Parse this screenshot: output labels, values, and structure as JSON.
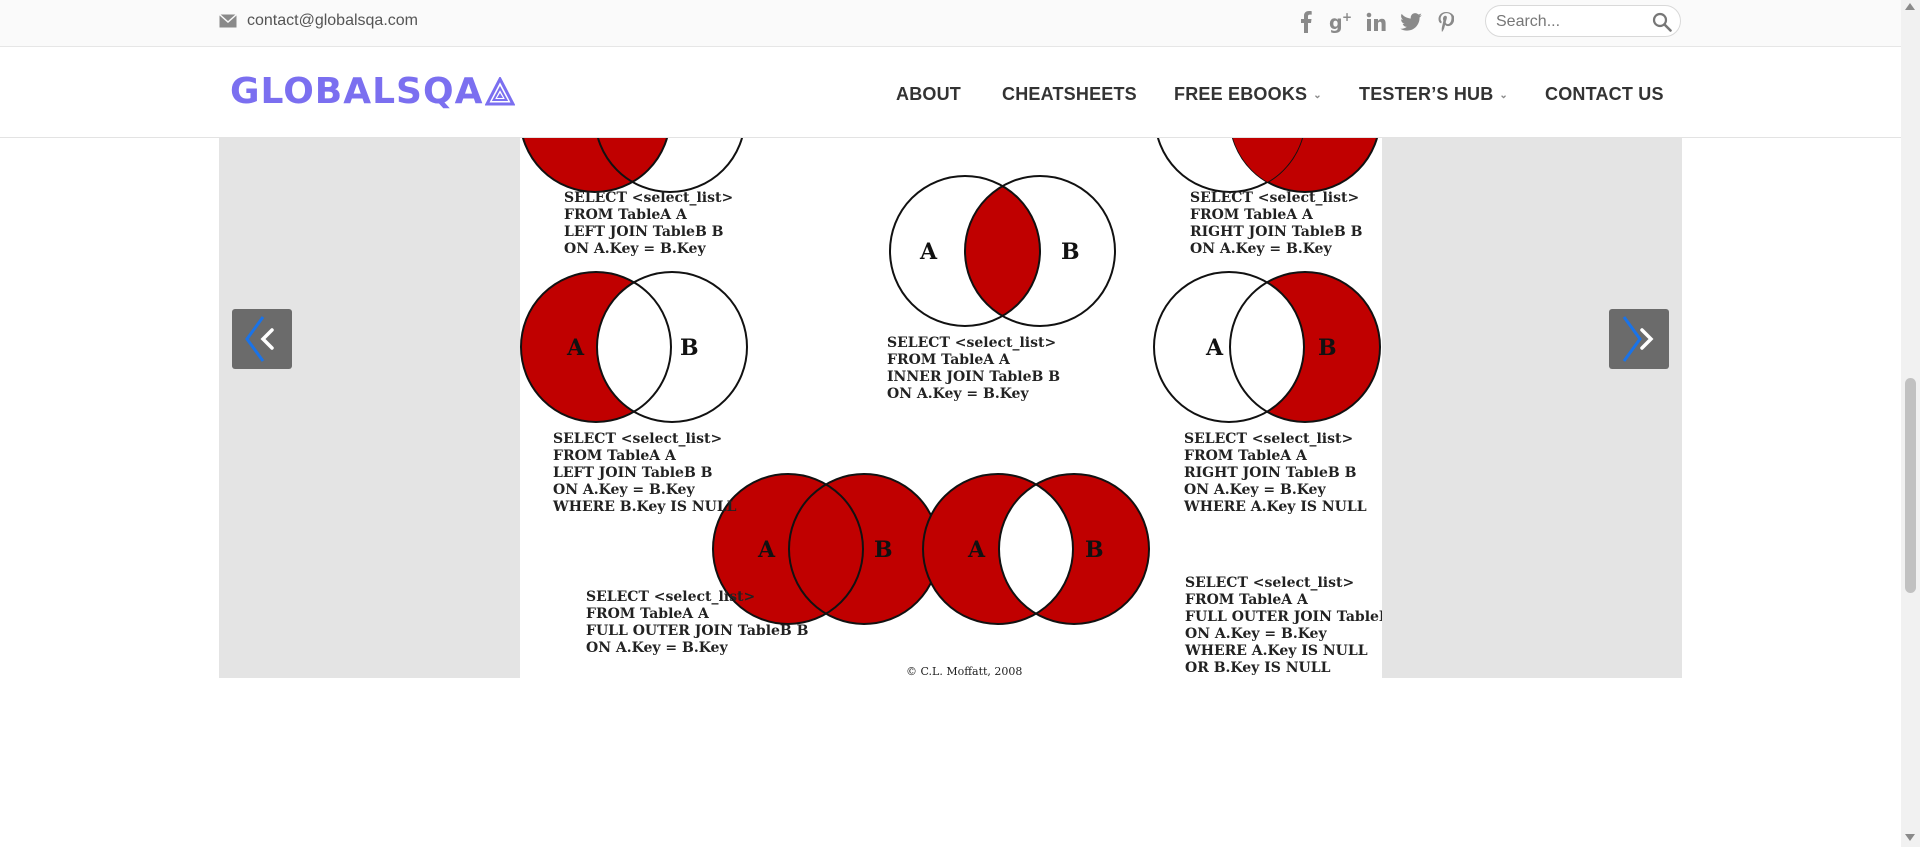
{
  "topbar": {
    "email": "contact@globalsqa.com",
    "search_placeholder": "Search..."
  },
  "header": {
    "logo_text": "GLOBALSQA",
    "nav": [
      {
        "label": "ABOUT",
        "has_dropdown": false
      },
      {
        "label": "CHEATSHEETS",
        "has_dropdown": false
      },
      {
        "label": "FREE EBOOKS",
        "has_dropdown": true
      },
      {
        "label": "TESTER’S HUB",
        "has_dropdown": true
      },
      {
        "label": "CONTACT US",
        "has_dropdown": false
      }
    ]
  },
  "diagram": {
    "labels": {
      "a": "A",
      "b": "B"
    },
    "queries": {
      "left_join_top": [
        "SELECT <select_list>",
        "FROM TableA A",
        "LEFT JOIN TableB B",
        "ON A.Key = B.Key"
      ],
      "right_join_top": [
        "SELECT <select_list>",
        "FROM TableA A",
        "RIGHT JOIN TableB B",
        "ON A.Key = B.Key"
      ],
      "inner_join": [
        "SELECT <select_list>",
        "FROM TableA A",
        "INNER JOIN TableB B",
        "ON A.Key = B.Key"
      ],
      "left_join_null": [
        "SELECT <select_list>",
        "FROM TableA A",
        "LEFT JOIN TableB B",
        "ON A.Key = B.Key",
        "WHERE B.Key IS NULL"
      ],
      "right_join_null": [
        "SELECT <select_list>",
        "FROM TableA A",
        "RIGHT JOIN TableB B",
        "ON A.Key = B.Key",
        "WHERE A.Key IS NULL"
      ],
      "full_outer": [
        "SELECT <select_list>",
        "FROM TableA A",
        "FULL OUTER JOIN TableB B",
        "ON A.Key = B.Key"
      ],
      "full_outer_null": [
        "SELECT <select_list>",
        "FROM TableA A",
        "FULL OUTER JOIN TableB B",
        "ON A.Key = B.Key",
        "WHERE A.Key IS NULL",
        "OR B.Key IS NULL"
      ]
    },
    "copyright": "© C.L. Moffatt, 2008"
  },
  "colors": {
    "accent": "#7b6ff0",
    "venn_fill": "#c00000",
    "arrow_bg": "#6b6b6b",
    "slider_bg": "#e4e4e4"
  },
  "icons": [
    "mail-icon",
    "facebook-icon",
    "google-plus-icon",
    "linkedin-icon",
    "twitter-icon",
    "pinterest-icon",
    "search-icon",
    "chevron-left-icon",
    "chevron-right-icon"
  ]
}
